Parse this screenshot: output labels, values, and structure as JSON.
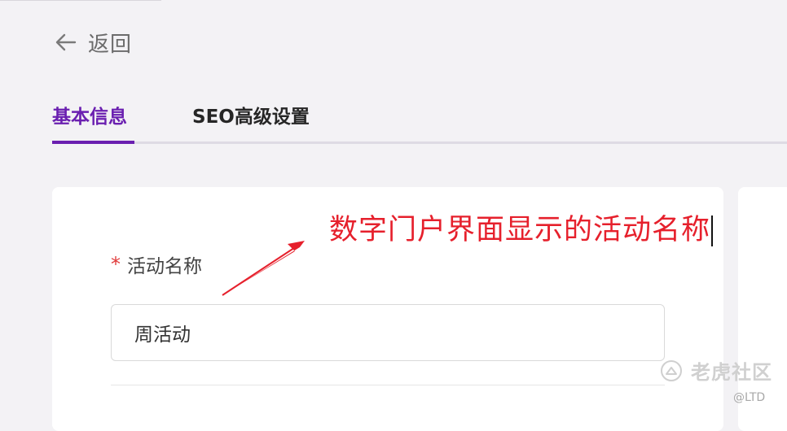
{
  "header": {
    "back_label": "返回"
  },
  "tabs": [
    {
      "label": "基本信息",
      "active": true
    },
    {
      "label": "SEO高级设置",
      "active": false
    }
  ],
  "form": {
    "name_field": {
      "required_mark": "*",
      "label": "活动名称",
      "value": "周活动"
    }
  },
  "annotation": {
    "text": "数字门户界面显示的活动名称",
    "color": "#e6202c"
  },
  "watermark": {
    "brand": "老虎社区",
    "handle": "@LTD"
  },
  "colors": {
    "accent": "#6a1fb0",
    "required": "#e03a3a",
    "background": "#f3f2f5"
  }
}
